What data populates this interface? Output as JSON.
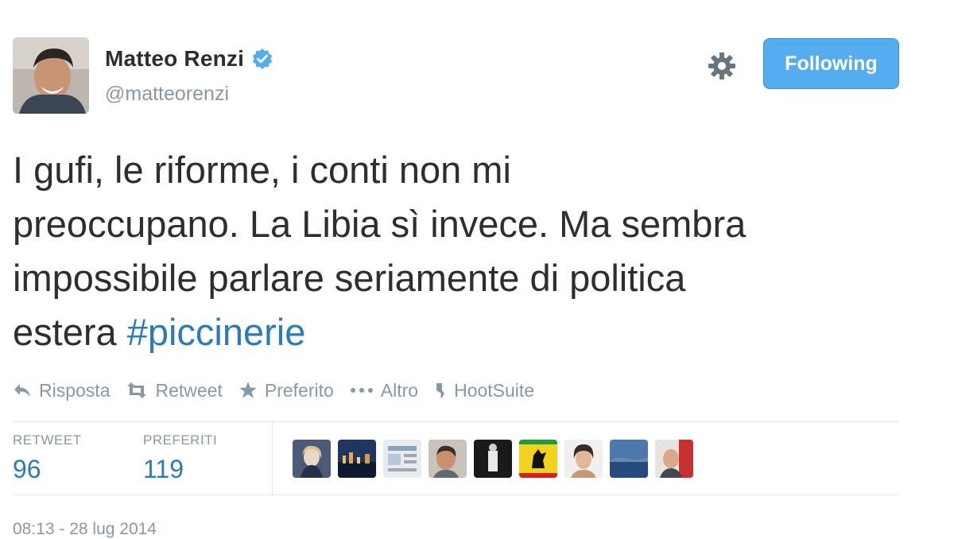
{
  "tweet": {
    "author": {
      "display_name": "Matteo Renzi",
      "handle": "@matteorenzi",
      "verified": true
    },
    "follow_button_label": "Following",
    "text_lines": [
      "I gufi, le riforme, i conti non mi",
      "preoccupano. La Libia sì invece. Ma sembra",
      "impossibile parlare seriamente di politica",
      "estera "
    ],
    "hashtag": "#piccinerie",
    "actions": {
      "reply": "Risposta",
      "retweet": "Retweet",
      "favorite": "Preferito",
      "more": "Altro",
      "hootsuite": "HootSuite"
    },
    "stats": {
      "retweets_label": "RETWEET",
      "retweets_count": "96",
      "favorites_label": "PREFERITI",
      "favorites_count": "119"
    },
    "timestamp": "08:13 - 28 lug 2014"
  },
  "colors": {
    "accent": "#55acee",
    "link": "#2b7bb9",
    "muted": "#8899a6",
    "text": "#292f33",
    "verified": "#55acee"
  },
  "icons": [
    "verified-badge-icon",
    "gear-icon",
    "reply-icon",
    "retweet-icon",
    "star-icon",
    "more-dots-icon",
    "hootsuite-icon"
  ],
  "favoriters_count_shown": 9
}
